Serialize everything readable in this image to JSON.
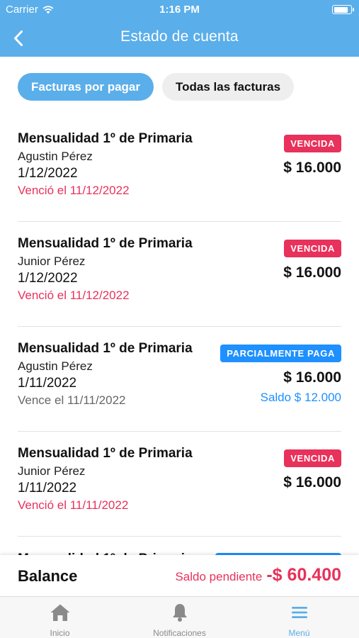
{
  "status_bar": {
    "carrier": "Carrier",
    "time": "1:16 PM"
  },
  "nav": {
    "title": "Estado de cuenta",
    "back_icon": "chevron-left-icon"
  },
  "segments": {
    "active": "Facturas por pagar",
    "inactive": "Todas las facturas"
  },
  "invoices": [
    {
      "title": "Mensualidad 1º de Primaria",
      "student": "Agustin Pérez",
      "date": "1/12/2022",
      "due": "Venció el 11/12/2022",
      "status": "VENCIDA",
      "amount": "$ 16.000"
    },
    {
      "title": "Mensualidad 1º de Primaria",
      "student": "Junior Pérez",
      "date": "1/12/2022",
      "due": "Venció el 11/12/2022",
      "status": "VENCIDA",
      "amount": "$ 16.000"
    },
    {
      "title": "Mensualidad 1º de Primaria",
      "student": "Agustin Pérez",
      "date": "1/11/2022",
      "due": "Vence el 11/11/2022",
      "status": "PARCIALMENTE PAGA",
      "amount": "$ 16.000",
      "saldo": "Saldo $ 12.000"
    },
    {
      "title": "Mensualidad 1º de Primaria",
      "student": "Junior Pérez",
      "date": "1/11/2022",
      "due": "Venció el 11/11/2022",
      "status": "VENCIDA",
      "amount": "$ 16.000"
    }
  ],
  "balance": {
    "label": "Balance",
    "caption": "Saldo pendiente",
    "amount": "-$ 60.400"
  },
  "tabs": [
    {
      "label": "Inicio",
      "icon": "home-icon"
    },
    {
      "label": "Notificaciones",
      "icon": "bell-icon"
    },
    {
      "label": "Menú",
      "icon": "menu-icon"
    }
  ],
  "colors": {
    "accent": "#5aaeea",
    "overdue": "#e8315b",
    "partial": "#1e90ff"
  }
}
